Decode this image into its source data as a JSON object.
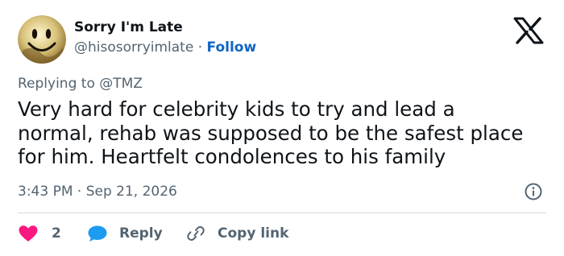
{
  "author": {
    "display_name": "Sorry I'm Late",
    "handle": "@hisosorryimlate",
    "separator": "·",
    "follow_label": "Follow"
  },
  "reply": {
    "prefix": "Replying to",
    "mention": "@TMZ"
  },
  "tweet": {
    "text": "Very hard for celebrity kids to try and lead a\nnormal, rehab was supposed to be the safest place\nfor him. Heartfelt condolences to his family",
    "timestamp": "3:43 PM · Sep 21, 2026"
  },
  "actions": {
    "like_count": "2",
    "reply_label": "Reply",
    "copy_label": "Copy link"
  },
  "colors": {
    "accent": "#0f65c5",
    "like": "#f91880",
    "reply_icon": "#1d9bf0",
    "muted": "#536471"
  },
  "icons": {
    "avatar": "smiley-face-icon",
    "brand": "x-logo-icon",
    "info": "info-icon",
    "like": "heart-icon",
    "reply": "chat-bubble-icon",
    "copy": "link-icon"
  }
}
